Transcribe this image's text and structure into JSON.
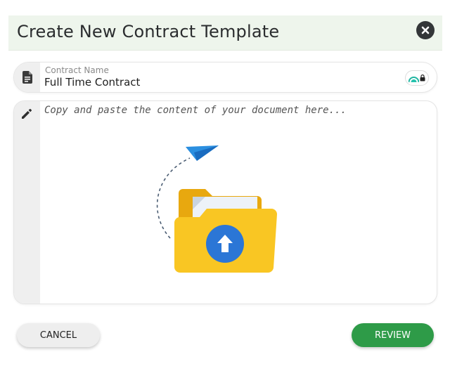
{
  "dialog": {
    "title": "Create New Contract Template",
    "close_icon": "close-icon"
  },
  "contract_name": {
    "label": "Contract Name",
    "value": "Full Time Contract",
    "icon": "document-icon",
    "password_manager_icon": "lock-icon"
  },
  "content": {
    "placeholder": "Copy and paste the content of your document here...",
    "value": "",
    "icon": "pencil-icon",
    "illustration": "folder-upload-illustration"
  },
  "actions": {
    "cancel_label": "CANCEL",
    "review_label": "REVIEW"
  },
  "colors": {
    "header_bg": "#eef5ec",
    "primary": "#2e9b48",
    "folder": "#f9c623",
    "upload_circle": "#2b76d6",
    "plane": "#2b8fe0"
  }
}
